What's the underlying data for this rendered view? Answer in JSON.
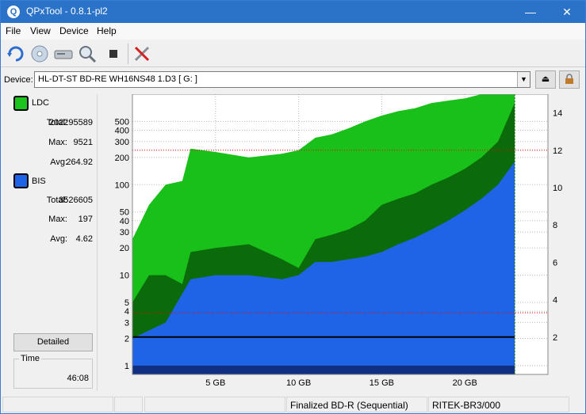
{
  "window": {
    "title": "QPxTool - 0.8.1-pl2",
    "app_icon_letter": "Q"
  },
  "menu": [
    "File",
    "View",
    "Device",
    "Help"
  ],
  "toolbar": {
    "icons": [
      "refresh-icon",
      "disc-icon",
      "drive-icon",
      "scan-icon",
      "stop-icon",
      "tools-icon"
    ]
  },
  "device": {
    "label": "Device:",
    "value": "HL-DT-ST BD-RE  WH16NS48  1.D3 [ G: ]"
  },
  "stats": {
    "ldc": {
      "name": "LDC",
      "color": "#1ec41e",
      "total_label": "Total:",
      "total": "202295589",
      "max_label": "Max:",
      "max": "9521",
      "avg_label": "Avg:",
      "avg": "264.92"
    },
    "bis": {
      "name": "BIS",
      "color": "#1f63e6",
      "total_label": "Total:",
      "total": "3526605",
      "max_label": "Max:",
      "max": "197",
      "avg_label": "Avg:",
      "avg": "4.62"
    }
  },
  "detailed_label": "Detailed",
  "time": {
    "label": "Time",
    "value": "46:08"
  },
  "status": {
    "disc_type": "Finalized BD-R (Sequential)",
    "media_id": "RITEK-BR3/000"
  },
  "chart_data": {
    "type": "area",
    "x_unit": "GB",
    "xlim": [
      0,
      25
    ],
    "x_ticks": [
      5,
      10,
      15,
      20
    ],
    "x_tick_labels": [
      "5 GB",
      "10 GB",
      "15 GB",
      "20 GB"
    ],
    "left_axis": {
      "scale": "log",
      "ylim": [
        0.8,
        1000
      ],
      "ticks": [
        1,
        2,
        3,
        4,
        5,
        10,
        20,
        30,
        40,
        50,
        100,
        200,
        300,
        400,
        500
      ]
    },
    "right_axis": {
      "ylim": [
        0,
        15
      ],
      "ticks": [
        2,
        4,
        6,
        8,
        10,
        12,
        14
      ]
    },
    "grid": true,
    "series": [
      {
        "name": "LDC",
        "color": "#19c019",
        "dark_color": "#0b6b0b",
        "x": [
          0,
          1,
          2,
          3,
          3.5,
          5,
          7,
          9,
          10,
          11,
          12,
          13,
          14,
          15,
          16,
          17,
          18,
          19,
          20,
          21,
          22,
          23
        ],
        "upper": [
          25,
          60,
          100,
          110,
          250,
          230,
          200,
          220,
          240,
          330,
          360,
          420,
          500,
          580,
          650,
          700,
          800,
          850,
          900,
          1000,
          1000,
          1000
        ],
        "lower": [
          5,
          10,
          10,
          8,
          18,
          20,
          22,
          15,
          12,
          25,
          28,
          32,
          40,
          60,
          70,
          80,
          100,
          120,
          150,
          200,
          300,
          800
        ]
      },
      {
        "name": "BIS",
        "color": "#1f63e6",
        "dark_color": "#0e2f82",
        "x": [
          0,
          2,
          3.5,
          5,
          7,
          9,
          10,
          11,
          12,
          13,
          14,
          15,
          16,
          17,
          18,
          19,
          20,
          21,
          22,
          23
        ],
        "upper": [
          2,
          3,
          9,
          10,
          10,
          9,
          10,
          14,
          14,
          15,
          16,
          18,
          22,
          26,
          32,
          40,
          52,
          70,
          100,
          180
        ],
        "lower": [
          1,
          1,
          1,
          1,
          1,
          1,
          1,
          1,
          1,
          1,
          1,
          1,
          1,
          1,
          1,
          1,
          1,
          1,
          1,
          1
        ]
      }
    ],
    "speed": {
      "name": "speed",
      "color": "#000000",
      "x": [
        0,
        23
      ],
      "y": [
        2,
        2
      ]
    },
    "ref_lines": [
      {
        "axis": "right",
        "value": 12,
        "color": "#ff0000"
      },
      {
        "axis": "right",
        "value": 3.3,
        "color": "#ff0000"
      }
    ]
  }
}
